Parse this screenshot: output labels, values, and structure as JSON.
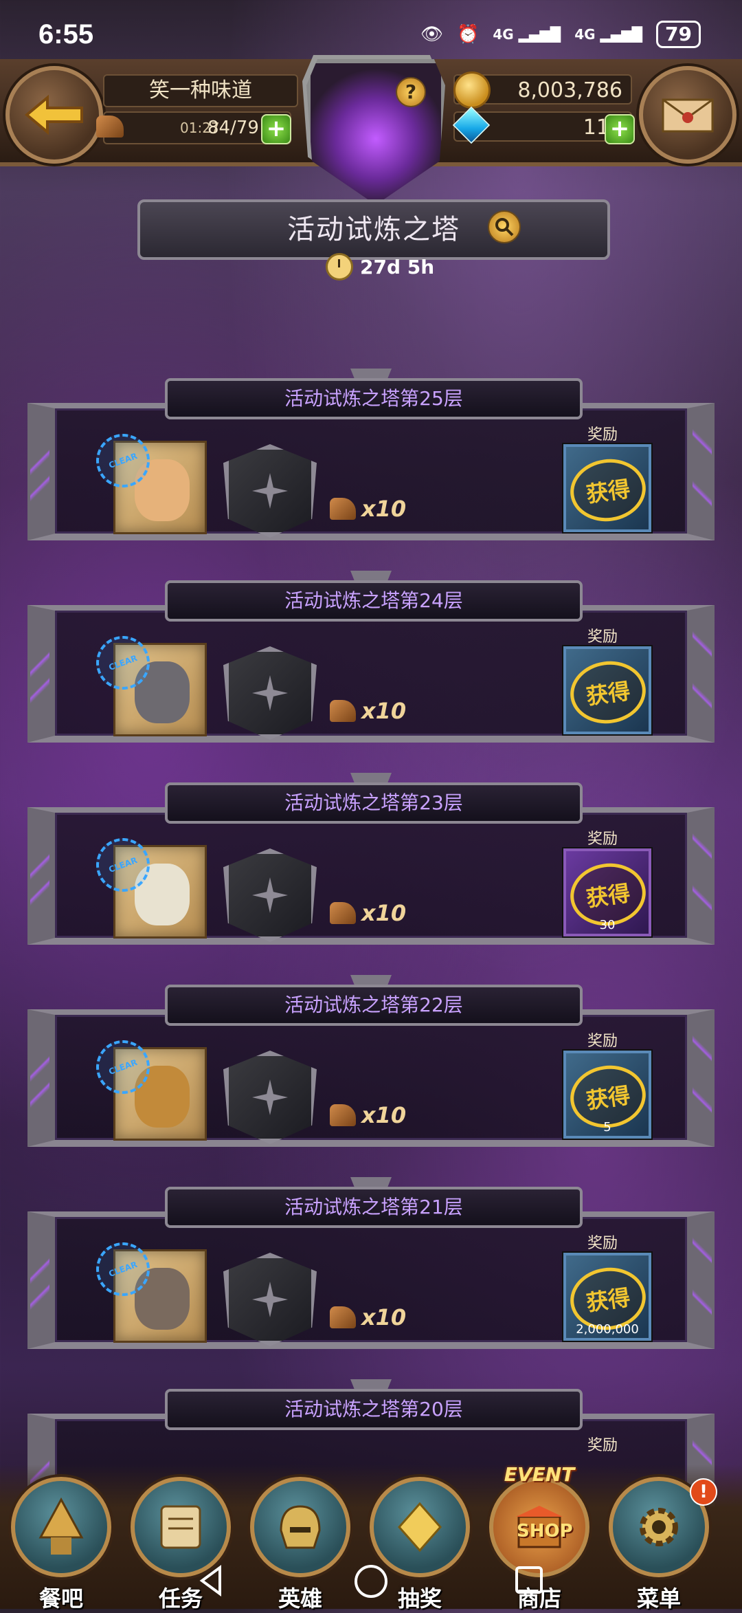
{
  "status_bar": {
    "time": "6:55",
    "battery": "79",
    "network1": "4G",
    "network2": "4G"
  },
  "header": {
    "player_name": "笑一种味道",
    "stamina_timer": "01:27",
    "stamina": "84/79",
    "gold": "8,003,786",
    "gems": "119",
    "help": "?"
  },
  "event": {
    "title": "活动试炼之塔",
    "remaining": "27d 5h"
  },
  "floors": [
    {
      "title": "活动试炼之塔第25层",
      "cost": "x10",
      "reward_label": "奖励",
      "status": "获得",
      "clear": "CLEAR",
      "reward_amount": "",
      "color": "blue"
    },
    {
      "title": "活动试炼之塔第24层",
      "cost": "x10",
      "reward_label": "奖励",
      "status": "获得",
      "clear": "CLEAR",
      "reward_amount": "",
      "color": "blue"
    },
    {
      "title": "活动试炼之塔第23层",
      "cost": "x10",
      "reward_label": "奖励",
      "status": "获得",
      "clear": "CLEAR",
      "reward_amount": "30",
      "color": "purple"
    },
    {
      "title": "活动试炼之塔第22层",
      "cost": "x10",
      "reward_label": "奖励",
      "status": "获得",
      "clear": "CLEAR",
      "reward_amount": "5",
      "color": "blue"
    },
    {
      "title": "活动试炼之塔第21层",
      "cost": "x10",
      "reward_label": "奖励",
      "status": "获得",
      "clear": "CLEAR",
      "reward_amount": "2,000,000",
      "color": "blue"
    },
    {
      "title": "活动试炼之塔第20层",
      "cost": "",
      "reward_label": "奖励",
      "status": "",
      "clear": "",
      "reward_amount": "",
      "color": "blue"
    }
  ],
  "bottom_nav": {
    "items": [
      {
        "label": "餐吧"
      },
      {
        "label": "任务"
      },
      {
        "label": "英雄"
      },
      {
        "label": "抽奖"
      },
      {
        "label": "商店"
      },
      {
        "label": "菜单"
      }
    ],
    "event_badge": "EVENT",
    "shop_badge": "SHOP",
    "alert": "!"
  }
}
